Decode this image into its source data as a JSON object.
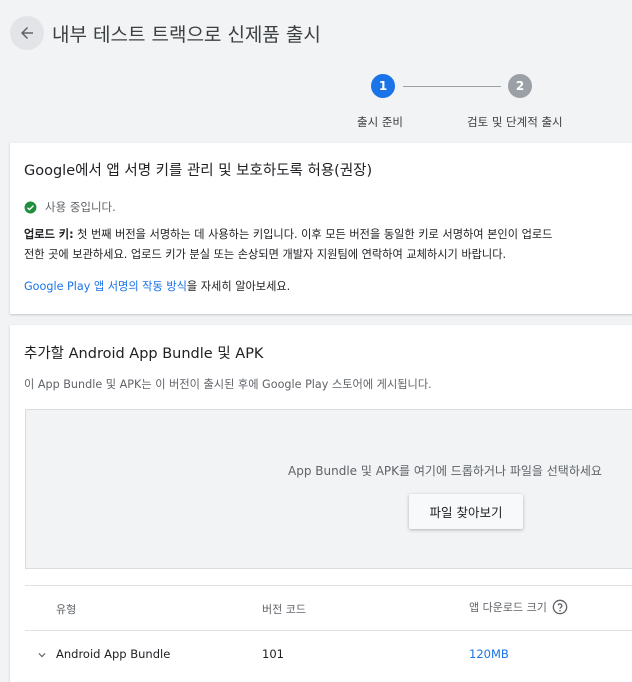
{
  "header": {
    "title": "내부 테스트 트랙으로 신제품 출시"
  },
  "stepper": {
    "steps": [
      {
        "number": "1",
        "label": "출시 준비",
        "color": "#1a73e8"
      },
      {
        "number": "2",
        "label": "검토 및 단계적 출시",
        "color": "#9aa0a6"
      }
    ]
  },
  "signing_card": {
    "title": "Google에서 앱 서명 키를 관리 및 보호하도록 허용(권장)",
    "status": "사용 중입니다.",
    "upload_key_label": "업로드 키:",
    "upload_key_text": " 첫 번째 버전을 서명하는 데 사용하는 키입니다. 이후 모든 버전을 동일한 키로 서명하여 본인이 업로드",
    "upload_key_text_2": "전한 곳에 보관하세요. 업로드 키가 분실 또는 손상되면 개발자 지원팀에 연락하여 교체하시기 바랍니다.",
    "link_text": "Google Play 앱 서명의 작동 방식",
    "link_suffix": "을 자세히 알아보세요."
  },
  "bundles_card": {
    "title": "추가할 Android App Bundle 및 APK",
    "description": "이 App Bundle 및 APK는 이 버전이 출시된 후에 Google Play 스토어에 게시됩니다.",
    "drop_text": "App Bundle 및 APK를 여기에 드롭하거나 파일을 선택하세요",
    "browse_button": "파일 찾아보기",
    "table": {
      "columns": [
        "유형",
        "버전 코드",
        "앱 다운로드 크기"
      ],
      "rows": [
        {
          "type": "Android App Bundle",
          "version_code": "101",
          "download_size": "120MB"
        }
      ]
    }
  },
  "colors": {
    "accent": "#1a73e8",
    "success": "#1e8e3e",
    "inactive_step": "#9aa0a6"
  },
  "icons": [
    "arrow-back-icon",
    "check-circle-icon",
    "help-icon",
    "chevron-down-icon"
  ]
}
